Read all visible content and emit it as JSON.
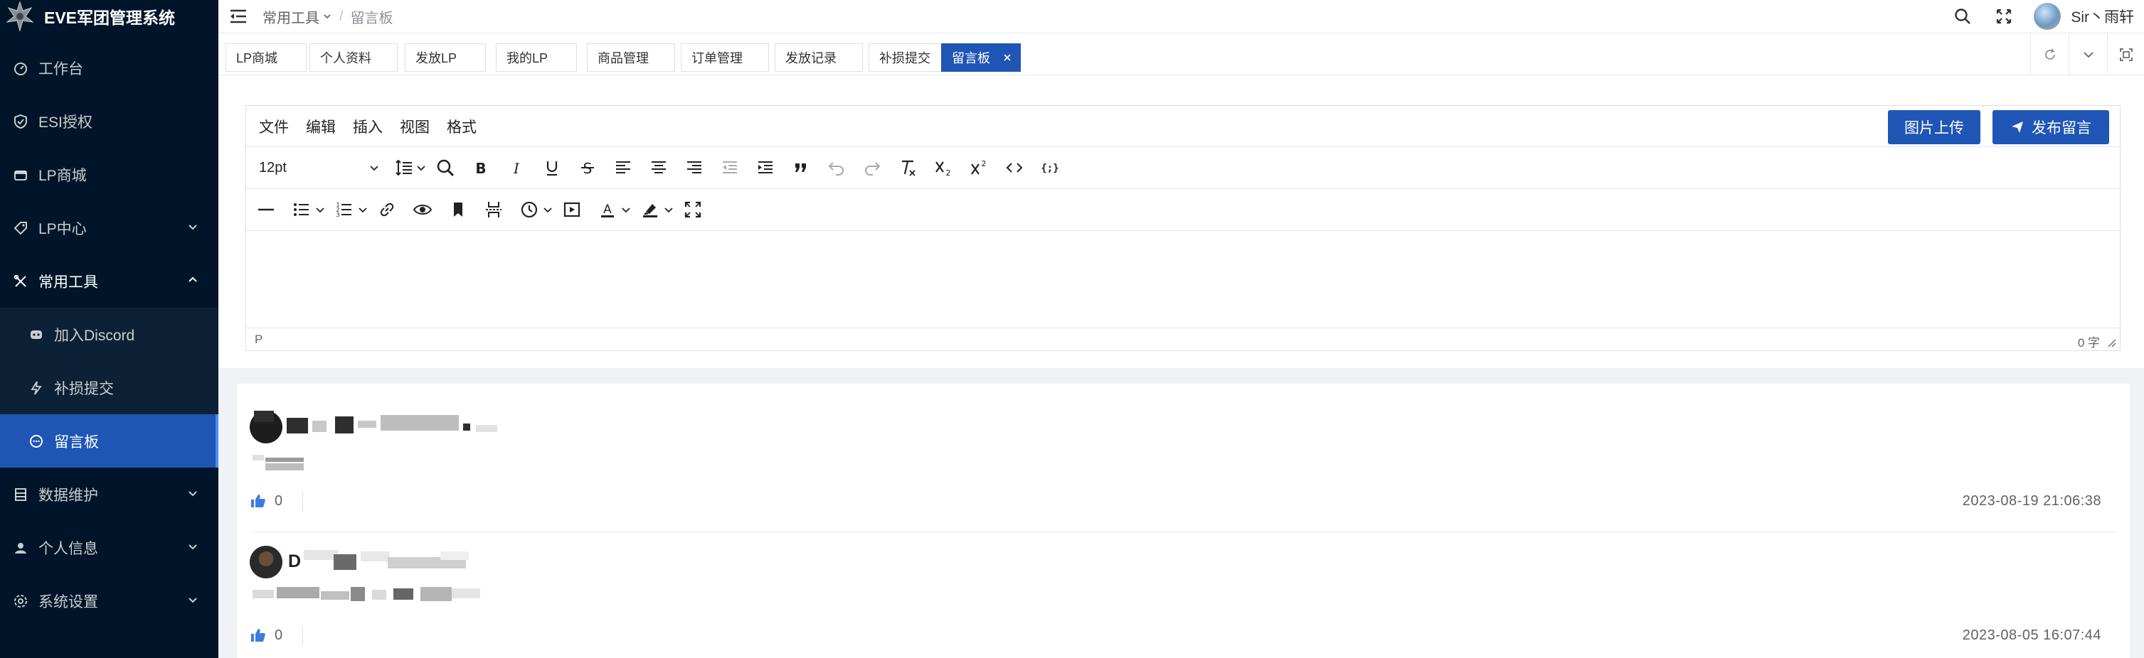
{
  "app": {
    "title": "EVE军团管理系统"
  },
  "sidebar": {
    "items": [
      {
        "label": "工作台",
        "icon": "dashboard-icon"
      },
      {
        "label": "ESI授权",
        "icon": "shield-icon"
      },
      {
        "label": "LP商城",
        "icon": "shop-icon"
      },
      {
        "label": "LP中心",
        "icon": "tag-icon"
      },
      {
        "label": "常用工具",
        "icon": "tools-icon"
      },
      {
        "label": "加入Discord",
        "icon": "discord-icon"
      },
      {
        "label": "补损提交",
        "icon": "bolt-icon"
      },
      {
        "label": "留言板",
        "icon": "chat-icon"
      },
      {
        "label": "数据维护",
        "icon": "database-icon"
      },
      {
        "label": "个人信息",
        "icon": "user-icon"
      },
      {
        "label": "系统设置",
        "icon": "gear-icon"
      }
    ]
  },
  "header": {
    "breadcrumb": {
      "parent": "常用工具",
      "separator": "/",
      "current": "留言板"
    },
    "user": {
      "name": "Sir丶雨轩"
    }
  },
  "tags": [
    "LP商城",
    "个人资料",
    "发放LP",
    "我的LP",
    "商品管理",
    "订单管理",
    "发放记录",
    "补损提交",
    "留言板"
  ],
  "editor": {
    "menus": [
      "文件",
      "编辑",
      "插入",
      "视图",
      "格式"
    ],
    "upload_button": "图片上传",
    "publish_button": "发布留言",
    "font_size": "12pt",
    "path": "P",
    "word_count": "0 字"
  },
  "messages": [
    {
      "likes": "0",
      "time": "2023-08-19 21:06:38"
    },
    {
      "likes": "0",
      "time": "2023-08-05 16:07:44"
    }
  ],
  "colors": {
    "sidebar_bg": "#001529",
    "accent": "#1f56b5"
  }
}
